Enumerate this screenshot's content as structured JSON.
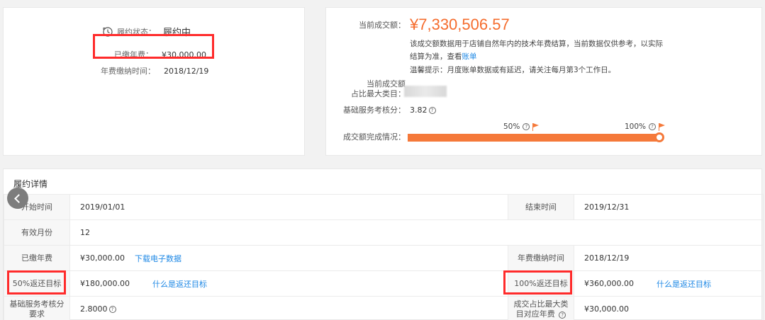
{
  "summary": {
    "status_label": "履约状态：",
    "status_value": "履约中",
    "paid_label": "已缴年费：",
    "paid_value": "¥30,000.00",
    "pay_time_label": "年费缴纳时间：",
    "pay_time_value": "2018/12/19"
  },
  "trade": {
    "amount_label": "当前成交额：",
    "amount_value": "¥7,330,506.57",
    "note_line1": "该成交额数据用于店铺自然年内的技术年费结算，当前数据仅供参考，以实际",
    "note_line2_prefix": "结算为准，查看",
    "note_line2_link": "账单",
    "note_line3": "温馨提示：月度账单数据或有延迟，请关注每月第3个工作日。",
    "ratio_label_1": "当前成交额",
    "ratio_label_2": "占比最大类目：",
    "score_label": "基础服务考核分：",
    "score_value": "3.82",
    "progress_label": "成交额完成情况：",
    "progress_fraction": 1.0,
    "marker_50": "50%",
    "marker_100": "100%",
    "accent_color": "#f5793a"
  },
  "detail": {
    "title": "履约详情",
    "rows": [
      {
        "l1": "开始时间",
        "v1": "2019/01/01",
        "l2": "结束时间",
        "v2": "2019/12/31"
      },
      {
        "l1": "有效月份",
        "v1": "12"
      },
      {
        "l1": "已缴年费",
        "v1": "¥30,000.00",
        "link1": "下载电子数据",
        "l2": "年费缴纳时间",
        "v2": "2018/12/19"
      },
      {
        "l1": "50%返还目标",
        "v1": "¥180,000.00",
        "link1": "什么是返还目标",
        "l2": "100%返还目标",
        "v2": "¥360,000.00",
        "link2": "什么是返还目标"
      },
      {
        "l1": "基础服务考核分要求",
        "v1": "2.8000",
        "l2": "成交占比最大类目对应年费",
        "v2": "¥30,000.00"
      }
    ]
  },
  "icons": [
    "clock-icon",
    "question-icon",
    "flag-icon",
    "back-chevron-icon"
  ]
}
